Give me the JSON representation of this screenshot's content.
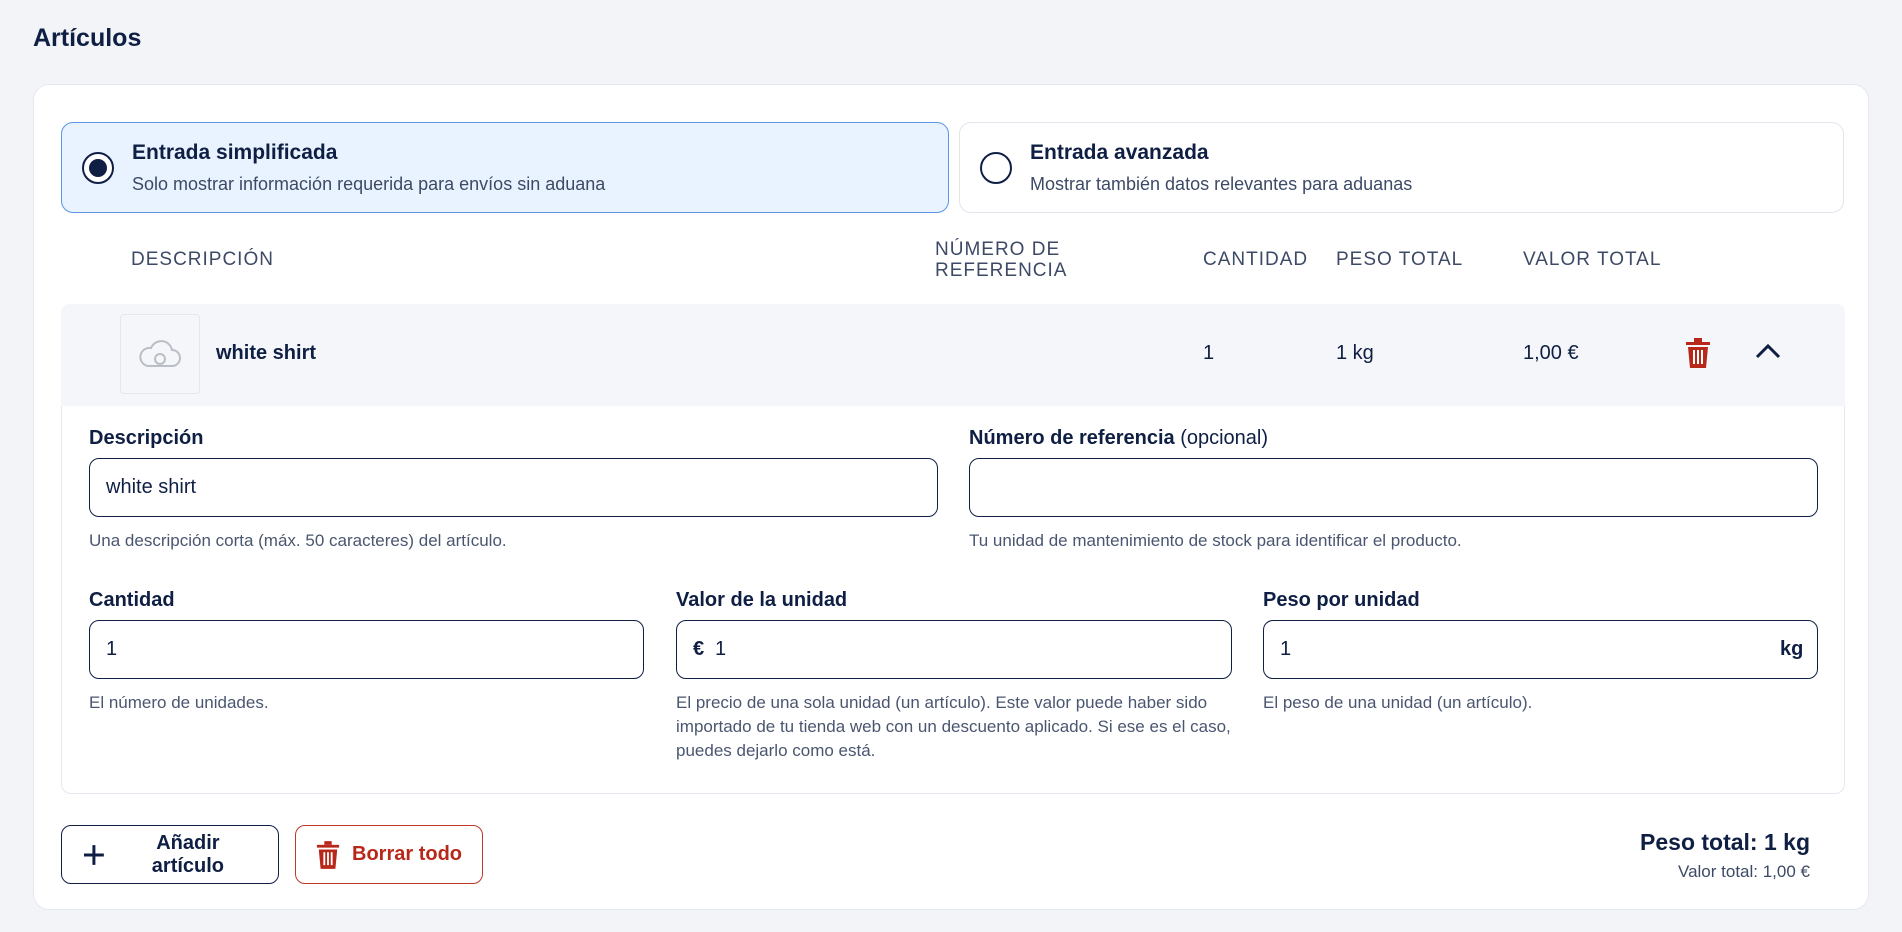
{
  "section": {
    "title": "Artículos"
  },
  "entry_modes": [
    {
      "title": "Entrada simplificada",
      "subtitle": "Solo mostrar información requerida para envíos sin aduana",
      "selected": true
    },
    {
      "title": "Entrada avanzada",
      "subtitle": "Mostrar también datos relevantes para aduanas",
      "selected": false
    }
  ],
  "table": {
    "headers": {
      "description": "Descripción",
      "reference_line1": "Número de",
      "reference_line2": "referencia",
      "quantity": "Cantidad",
      "total_weight": "Peso total",
      "total_value": "Valor total"
    },
    "rows": [
      {
        "name": "white shirt",
        "quantity": "1",
        "weight": "1 kg",
        "value": "1,00 €",
        "image_icon": "cloud-icon"
      }
    ]
  },
  "detail": {
    "description": {
      "label": "Descripción",
      "value": "white shirt",
      "help": "Una descripción corta (máx. 50 caracteres) del artículo."
    },
    "reference": {
      "label": "Número de referencia",
      "optional": "(opcional)",
      "value": "",
      "help": "Tu unidad de mantenimiento de stock para identificar el producto."
    },
    "quantity": {
      "label": "Cantidad",
      "value": "1",
      "help": "El número de unidades."
    },
    "unit_value": {
      "label": "Valor de la unidad",
      "prefix": "€",
      "value": "1",
      "help": "El precio de una sola unidad (un artículo). Este valor puede haber sido importado de tu tienda web con un descuento aplicado. Si ese es el caso, puedes dejarlo como está."
    },
    "unit_weight": {
      "label": "Peso por unidad",
      "suffix": "kg",
      "value": "1",
      "help": "El peso de una unidad (un artículo)."
    }
  },
  "actions": {
    "add_label": "Añadir artículo",
    "clear_label": "Borrar todo"
  },
  "totals": {
    "weight": "Peso total: 1 kg",
    "value": "Valor total: 1,00 €"
  },
  "colors": {
    "navy": "#0f1f44",
    "danger": "#b8281a",
    "selected_bg": "#e9f3ff",
    "selected_border": "#5b93e6"
  }
}
